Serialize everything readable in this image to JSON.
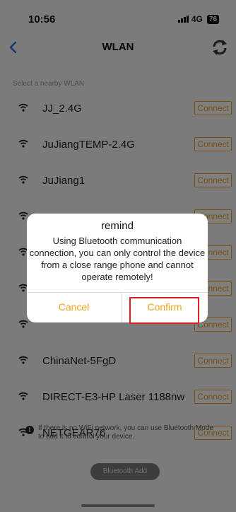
{
  "status": {
    "time": "10:56",
    "network": "4G",
    "battery": "76"
  },
  "nav": {
    "title": "WLAN"
  },
  "section_label": "Select a nearby WLAN",
  "networks": [
    {
      "name": "JJ_2.4G",
      "action": "Connect"
    },
    {
      "name": "JuJiangTEMP-2.4G",
      "action": "Connect"
    },
    {
      "name": "JuJiang1",
      "action": "Connect"
    },
    {
      "name": "",
      "action": "Connect"
    },
    {
      "name": "",
      "action": "Connect"
    },
    {
      "name": "",
      "action": "Connect"
    },
    {
      "name": "",
      "action": "Connect"
    },
    {
      "name": "ChinaNet-5FgD",
      "action": "Connect"
    },
    {
      "name": "DIRECT-E3-HP Laser 1188nw",
      "action": "Connect"
    },
    {
      "name": "NETGEAR76",
      "action": "Connect"
    }
  ],
  "help": {
    "icon": "!",
    "text": "If there is no WiFi network, you can use Bluetooth Mode to add it to control your device."
  },
  "bluetooth_add": "Bluetooth Add",
  "dialog": {
    "title": "remind",
    "message": "Using Bluetooth communication connection, you can only control the device from a close range phone and cannot operate remotely!",
    "cancel": "Cancel",
    "confirm": "Confirm"
  },
  "colors": {
    "accent": "#f0a020",
    "highlight": "#e02020"
  }
}
